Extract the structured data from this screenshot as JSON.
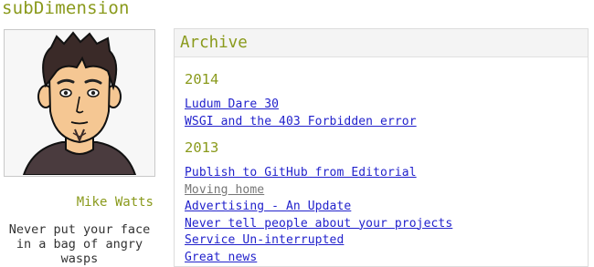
{
  "site": {
    "title": "subDimension"
  },
  "sidebar": {
    "author_name": "Mike Watts",
    "bio": "Never put your face\nin a bag of angry\nwasps"
  },
  "archive": {
    "heading": "Archive",
    "groups": [
      {
        "year": "2014",
        "posts": [
          {
            "title": "Ludum Dare 30"
          },
          {
            "title": "WSGI and the 403 Forbidden error"
          }
        ]
      },
      {
        "year": "2013",
        "posts": [
          {
            "title": "Publish to GitHub from Editorial"
          },
          {
            "title": "Moving home"
          },
          {
            "title": "Advertising - An Update"
          },
          {
            "title": "Never tell people about your projects"
          },
          {
            "title": "Service Un-interrupted"
          },
          {
            "title": "Great news"
          }
        ]
      }
    ]
  },
  "colors": {
    "accent": "#8a9a1c",
    "link": "#2222cc",
    "visited_link": "#777777"
  }
}
